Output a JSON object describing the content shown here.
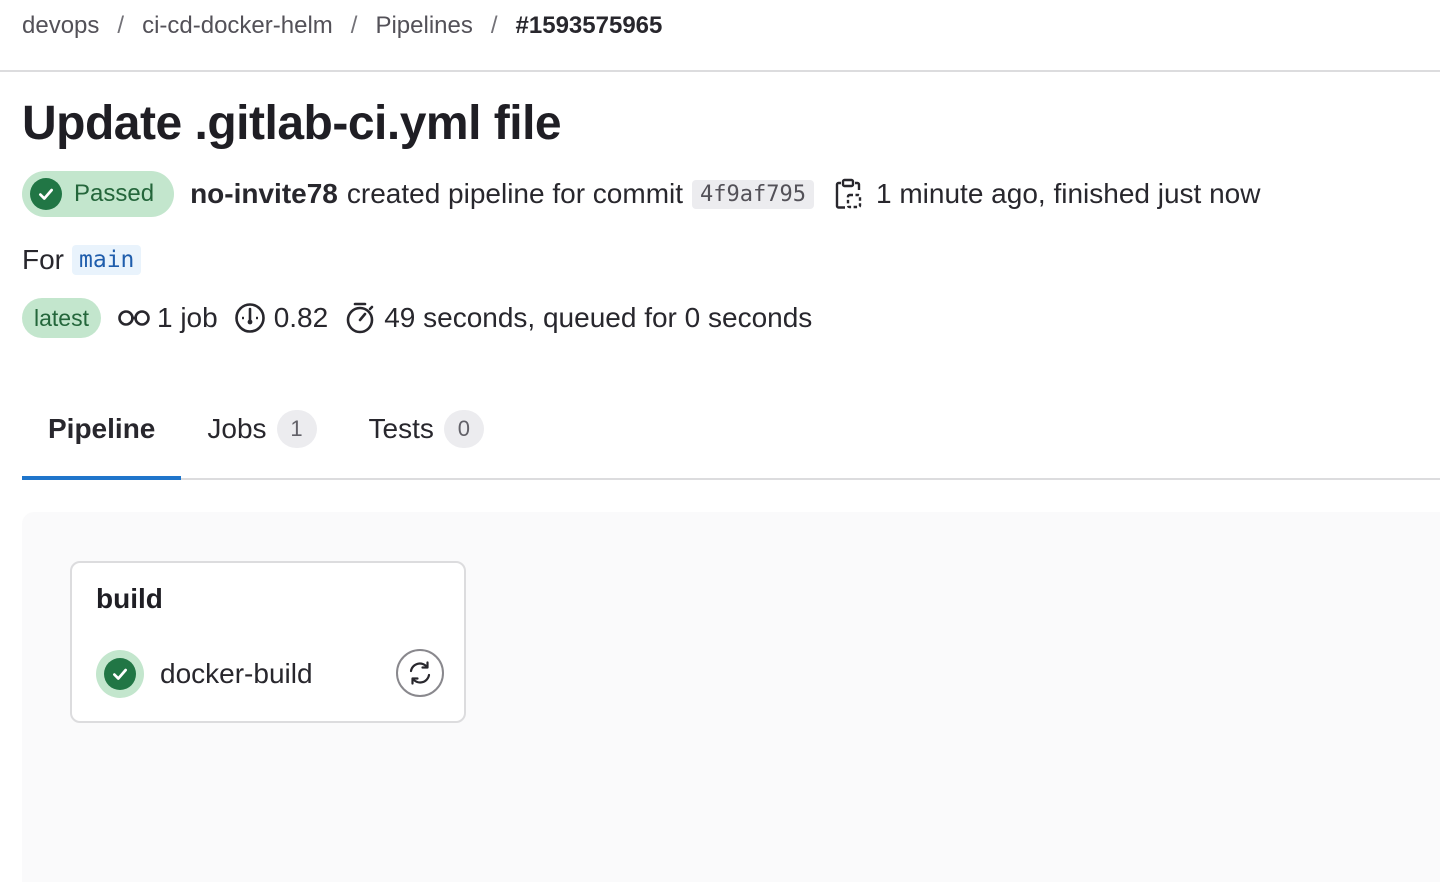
{
  "breadcrumb": {
    "items": [
      "devops",
      "ci-cd-docker-helm",
      "Pipelines"
    ],
    "current": "#1593575965",
    "separator": "/"
  },
  "page_title": "Update .gitlab-ci.yml file",
  "status": {
    "badge": "Passed",
    "author": "no-invite78",
    "text": "created pipeline for commit",
    "sha": "4f9af795",
    "time": "1 minute ago, finished just now"
  },
  "ref": {
    "label": "For",
    "branch": "main"
  },
  "meta": {
    "latest": "latest",
    "jobs": "1 job",
    "score": "0.82",
    "duration": "49 seconds, queued for 0 seconds"
  },
  "tabs": [
    {
      "label": "Pipeline",
      "count": null
    },
    {
      "label": "Jobs",
      "count": "1"
    },
    {
      "label": "Tests",
      "count": "0"
    }
  ],
  "graph": {
    "stage": "build",
    "job": "docker-build"
  },
  "colors": {
    "success": "#217645",
    "success_bg": "#c3e6cd",
    "tab_active": "#1f75cb"
  }
}
